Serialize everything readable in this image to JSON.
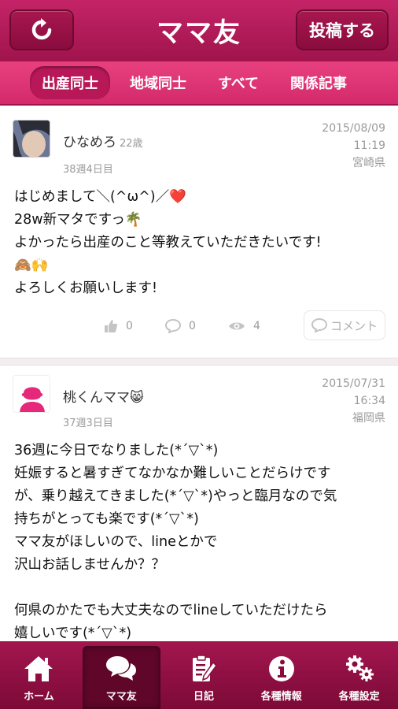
{
  "header": {
    "title": "ママ友",
    "refresh_icon": "refresh-icon",
    "post_label": "投稿する"
  },
  "tabs": [
    {
      "label": "出産同士",
      "active": true
    },
    {
      "label": "地域同士",
      "active": false
    },
    {
      "label": "すべて",
      "active": false
    },
    {
      "label": "関係記事",
      "active": false
    }
  ],
  "posts": [
    {
      "name": "ひなめろ",
      "age": "22歳",
      "week": "38週4日目",
      "date": "2015/08/09",
      "time": "11:19",
      "prefecture": "宮崎県",
      "body": "はじめまして＼(^ω^)／❤️\n28w新マタですっ🌴\nよかったら出産のこと等教えていただきたいです!\n🙈🙌\nよろしくお願いします!",
      "likes": "0",
      "comments": "0",
      "views": "4",
      "comment_label": "コメント"
    },
    {
      "name": "桃くんママ😸",
      "week": "37週3日目",
      "date": "2015/07/31",
      "time": "16:34",
      "prefecture": "福岡県",
      "body": "36週に今日でなりました(*´▽`*)\n妊娠すると暑すぎてなかなか難しいことだらけです\nが、乗り越えてきました(*´▽`*)やっと臨月なので気\n持ちがとっても楽です(*´▽`*)\nママ友がほしいので、lineとかで\n沢山お話しませんか？？\n\n何県のかたでも大丈夫なのでlineしていただけたら\n嬉しいです(*´▽`*)"
    }
  ],
  "bottom_nav": [
    {
      "label": "ホーム",
      "icon": "home-icon",
      "active": false
    },
    {
      "label": "ママ友",
      "icon": "chat-bubbles-icon",
      "active": true
    },
    {
      "label": "日記",
      "icon": "diary-icon",
      "active": false
    },
    {
      "label": "各種情報",
      "icon": "info-icon",
      "active": false
    },
    {
      "label": "各種設定",
      "icon": "gears-icon",
      "active": false
    }
  ],
  "colors": {
    "brand": "#b81858",
    "brand_dark": "#7c0a37",
    "tab_bar": "#e8407f"
  }
}
